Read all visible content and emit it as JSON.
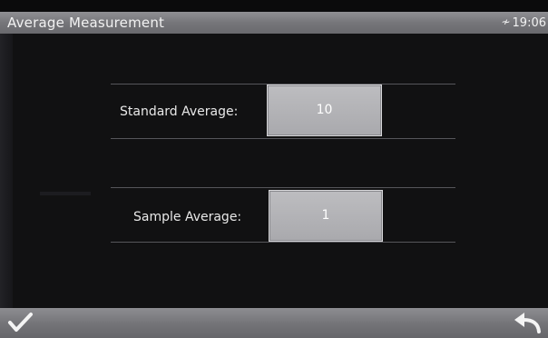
{
  "titlebar": {
    "title": "Average Measurement",
    "time": "19:06",
    "connection_icon": "plug-icon"
  },
  "fields": [
    {
      "label": "Standard Average:",
      "value": "10"
    },
    {
      "label": "Sample Average:",
      "value": "1"
    }
  ],
  "bottombar": {
    "confirm_icon": "checkmark-icon",
    "back_icon": "return-arrow-icon"
  }
}
